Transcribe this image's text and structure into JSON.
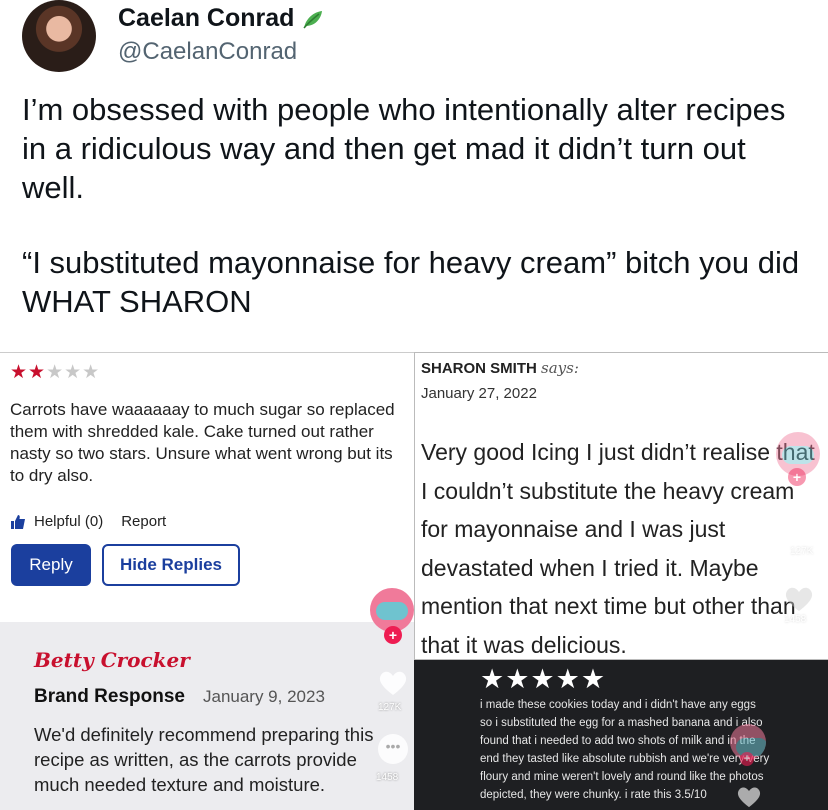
{
  "tweet": {
    "name": "Caelan Conrad",
    "handle": "@CaelanConrad",
    "paragraph1": "I’m obsessed with people who intentionally alter recipes in a ridiculous way and then get mad it didn’t turn out well.",
    "paragraph2": "“I substituted mayonnaise for heavy cream” bitch you did WHAT SHARON"
  },
  "review_kale": {
    "rating": 2,
    "rating_max": 5,
    "text": "Carrots have waaaaaay to much sugar so replaced them with shredded kale. Cake turned out rather nasty so two stars. Unsure what went wrong but its to dry also.",
    "helpful_label": "Helpful (0)",
    "report_label": "Report",
    "reply_label": "Reply",
    "hide_replies_label": "Hide Replies"
  },
  "brand_reply": {
    "brand": "Betty Crocker",
    "label": "Brand Response",
    "date": "January 9, 2023",
    "text": "We'd definitely recommend preparing this recipe as written, as the carrots provide much needed texture and moisture."
  },
  "sharon_comment": {
    "author": "SHARON SMITH",
    "says": "says:",
    "date": "January 27, 2022",
    "text": "Very good Icing I just didn’t realise that I couldn’t substitute the heavy cream for mayonnaise and I was just devastated when I tried it. Maybe mention that next time but other than that it was delicious."
  },
  "cookie_review": {
    "stars": "★★★★★",
    "text": "i made these cookies today and i didn't have any eggs so i substituted the egg for a mashed banana and i also found that i needed to add two shots of milk and in the end they tasted like absolute rubbish and we're very very floury and mine weren't lovely and round like the photos depicted, they were chunky. i rate this 3.5/10"
  },
  "overlay": {
    "likes_1": "127K",
    "comments_1": "1458",
    "likes_2": "127K",
    "likes_3": "1458"
  },
  "colors": {
    "star_red": "#c8102e",
    "button_blue": "#1b3f9e",
    "tiktok_pink": "#ee1d52"
  }
}
